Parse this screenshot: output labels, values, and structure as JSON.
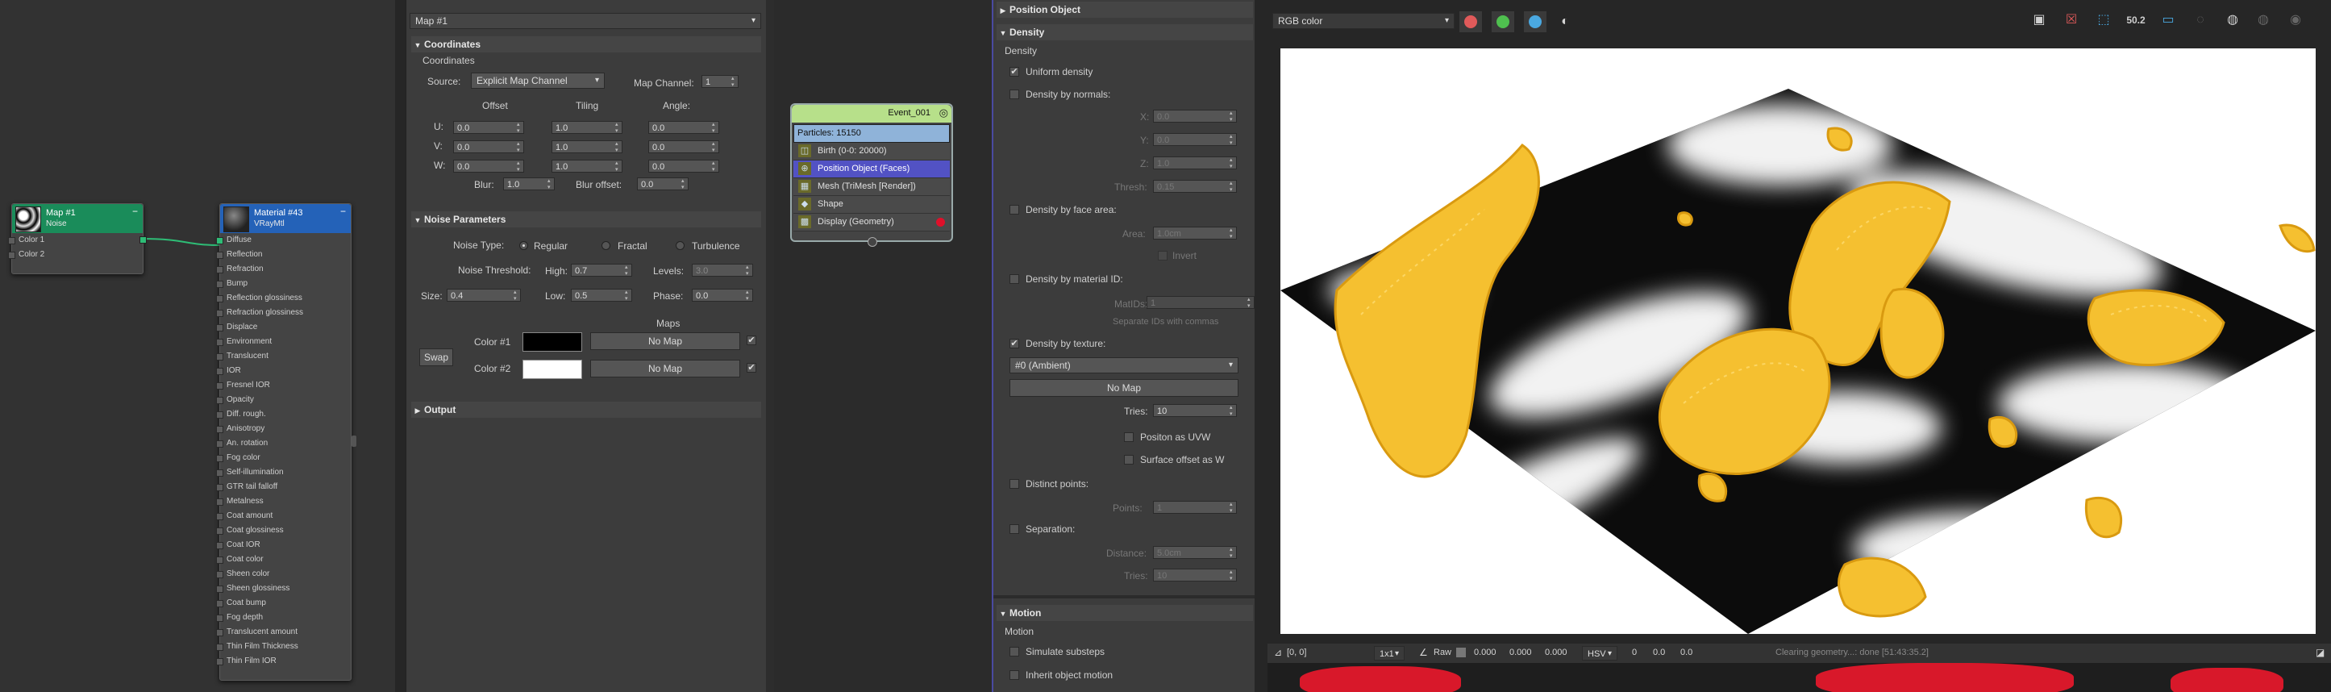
{
  "slate": {
    "map_node": {
      "title": "Map #1",
      "subtitle": "Noise",
      "slots": [
        "Color 1",
        "Color 2"
      ],
      "header_color": "#1a8c5a"
    },
    "material_node": {
      "title": "Material #43",
      "subtitle": "VRayMtl",
      "header_color": "#2462b8",
      "slots": [
        "Diffuse",
        "Reflection",
        "Refraction",
        "Bump",
        "Reflection glossiness",
        "Refraction glossiness",
        "Displace",
        "Environment",
        "Translucent",
        "IOR",
        "Fresnel IOR",
        "Opacity",
        "Diff. rough.",
        "Anisotropy",
        "An. rotation",
        "Fog color",
        "Self-illumination",
        "GTR tail falloff",
        "Metalness",
        "Coat amount",
        "Coat glossiness",
        "Coat IOR",
        "Coat color",
        "Sheen color",
        "Sheen glossiness",
        "Coat bump",
        "Fog depth",
        "Translucent amount",
        "Thin Film Thickness",
        "Thin Film IOR"
      ]
    }
  },
  "map_editor": {
    "map_name": "Map #1",
    "coordinates": {
      "title": "Coordinates",
      "subtitle": "Coordinates",
      "source_label": "Source:",
      "source_value": "Explicit Map Channel",
      "map_channel_label": "Map Channel:",
      "map_channel_value": "1",
      "col_offset": "Offset",
      "col_tiling": "Tiling",
      "col_angle": "Angle:",
      "rows": [
        {
          "axis": "U:",
          "offset": "0.0",
          "tiling": "1.0",
          "angle": "0.0"
        },
        {
          "axis": "V:",
          "offset": "0.0",
          "tiling": "1.0",
          "angle": "0.0"
        },
        {
          "axis": "W:",
          "offset": "0.0",
          "tiling": "1.0",
          "angle": "0.0"
        }
      ],
      "blur_label": "Blur:",
      "blur_value": "1.0",
      "blur_offset_label": "Blur offset:",
      "blur_offset_value": "0.0"
    },
    "noise": {
      "title": "Noise Parameters",
      "type_label": "Noise Type:",
      "types": [
        "Regular",
        "Fractal",
        "Turbulence"
      ],
      "selected_type": "Regular",
      "threshold_label": "Noise Threshold:",
      "high_label": "High:",
      "high_value": "0.7",
      "levels_label": "Levels:",
      "levels_value": "3.0",
      "size_label": "Size:",
      "size_value": "0.4",
      "low_label": "Low:",
      "low_value": "0.5",
      "phase_label": "Phase:",
      "phase_value": "0.0",
      "maps_label": "Maps",
      "swap_label": "Swap",
      "color1_label": "Color #1",
      "color1_swatch": "#000000",
      "color2_label": "Color #2",
      "color2_swatch": "#ffffff",
      "no_map": "No Map",
      "check_mark": "✔"
    },
    "output": {
      "title": "Output"
    }
  },
  "particle_view": {
    "event_name": "Event_001",
    "header_color": "#b7e08a",
    "operators": [
      {
        "label": "Particles: 15150"
      },
      {
        "label": "Birth (0-0: 20000)"
      },
      {
        "label": "Position Object (Faces)"
      },
      {
        "label": "Mesh (TriMesh [Render])"
      },
      {
        "label": "Shape"
      },
      {
        "label": "Display (Geometry)"
      }
    ]
  },
  "particle_params": {
    "position_title": "Position Object",
    "density_title": "Density",
    "density_sub": "Density",
    "uniform_density": "Uniform density",
    "by_normals": "Density by normals:",
    "x_label": "X:",
    "x_value": "0.0",
    "y_label": "Y:",
    "y_value": "0.0",
    "z_label": "Z:",
    "z_value": "1.0",
    "thresh_label": "Thresh:",
    "thresh_value": "0.15",
    "by_face_area": "Density by face area:",
    "area_label": "Area:",
    "area_value": "1.0cm",
    "invert": "Invert",
    "by_material": "Density by material ID:",
    "matids_label": "MatIDs:",
    "matids_value": "1",
    "separate_ids": "Separate IDs with commas",
    "by_texture": "Density by texture:",
    "texture_slot": "#0 (Ambient)",
    "no_map": "No Map",
    "tries_label": "Tries:",
    "tries_value": "10",
    "position_uvw": "Positon as UVW",
    "surface_offset": "Surface offset as W",
    "distinct_points": "Distinct points:",
    "points_label": "Points:",
    "points_value": "1",
    "separation": "Separation:",
    "distance_label": "Distance:",
    "distance_value": "5.0cm",
    "tries2_label": "Tries:",
    "tries2_value": "10",
    "motion_title": "Motion",
    "motion_sub": "Motion",
    "simulate_substeps": "Simulate substeps",
    "inherit_motion": "Inherit object motion",
    "check_mark": "✔"
  },
  "viewport": {
    "channel": "RGB color",
    "channel_dots": [
      "#e05a5a",
      "#4fc04f",
      "#4aa8e0"
    ],
    "toolbar_number": "50.2",
    "status": {
      "coords": "[0, 0]",
      "zoom": "1x1",
      "raw_label": "Raw",
      "rgb": [
        "0.000",
        "0.000",
        "0.000"
      ],
      "mode": "HSV",
      "hsv": [
        "0",
        "0.0",
        "0.0"
      ],
      "message": "Clearing geometry...: done [51:43:35.2]"
    }
  }
}
